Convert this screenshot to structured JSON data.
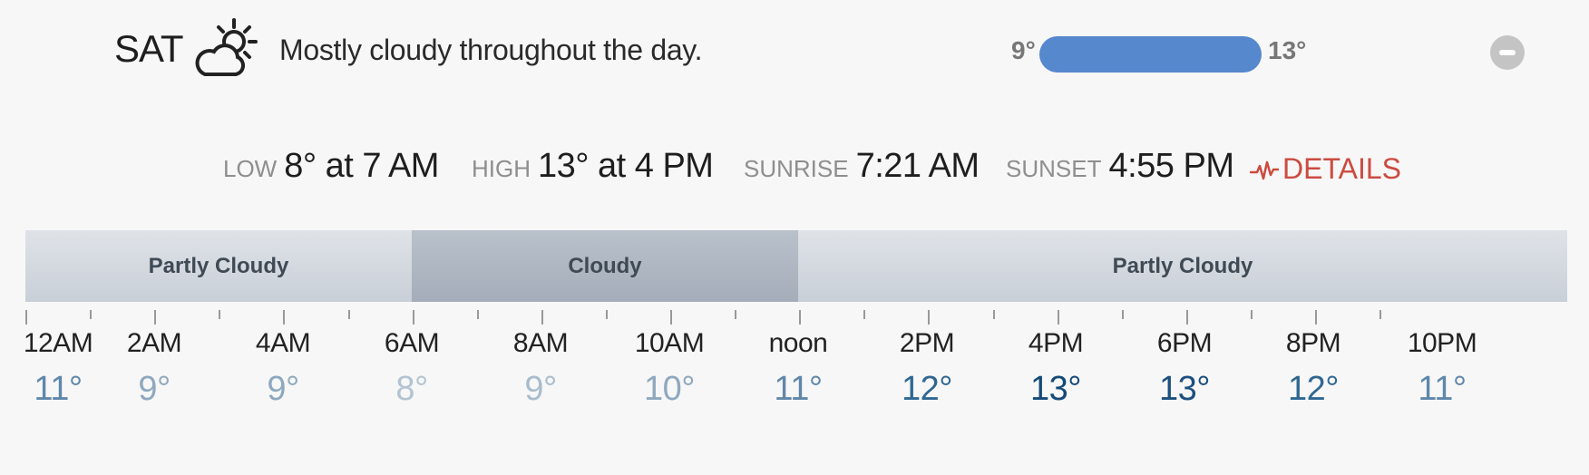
{
  "day": {
    "label": "SAT",
    "icon": "partly-cloudy-day-icon",
    "summary": "Mostly cloudy throughout the day.",
    "range_low": "9°",
    "range_high": "13°"
  },
  "stats": {
    "low_label": "LOW",
    "low_value": "8° at 7 AM",
    "high_label": "HIGH",
    "high_value": "13° at 4 PM",
    "sunrise_label": "SUNRISE",
    "sunrise_value": "7:21 AM",
    "sunset_label": "SUNSET",
    "sunset_value": "4:55 PM",
    "details_label": "DETAILS"
  },
  "conditions": [
    {
      "label": "Partly Cloudy",
      "kind": "partly"
    },
    {
      "label": "Cloudy",
      "kind": "cloudy"
    },
    {
      "label": "Partly Cloudy",
      "kind": "partly"
    }
  ],
  "hours": [
    {
      "time": "12AM",
      "temp": "11°",
      "color": "#5f87a9"
    },
    {
      "time": "2AM",
      "temp": "9°",
      "color": "#8ea8bf"
    },
    {
      "time": "4AM",
      "temp": "9°",
      "color": "#8ea8bf"
    },
    {
      "time": "6AM",
      "temp": "8°",
      "color": "#b3c3d2"
    },
    {
      "time": "8AM",
      "temp": "9°",
      "color": "#a8bccd"
    },
    {
      "time": "10AM",
      "temp": "10°",
      "color": "#8ea8bf"
    },
    {
      "time": "noon",
      "temp": "11°",
      "color": "#5f87a9"
    },
    {
      "time": "2PM",
      "temp": "12°",
      "color": "#2f6792"
    },
    {
      "time": "4PM",
      "temp": "13°",
      "color": "#144a78"
    },
    {
      "time": "6PM",
      "temp": "13°",
      "color": "#1b5080"
    },
    {
      "time": "8PM",
      "temp": "12°",
      "color": "#2f6792"
    },
    {
      "time": "10PM",
      "temp": "11°",
      "color": "#5f87a9"
    }
  ],
  "colors": {
    "range_bar": "#5588cc",
    "details": "#cc4b40"
  }
}
